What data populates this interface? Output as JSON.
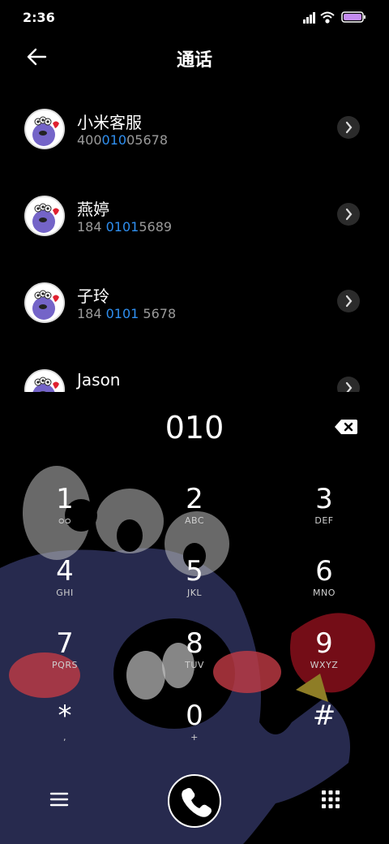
{
  "status": {
    "time": "2:36"
  },
  "header": {
    "title": "通话"
  },
  "contacts": [
    {
      "name": "小米客服",
      "number_pre": "400",
      "number_hl": "010",
      "number_post": "05678"
    },
    {
      "name": "燕婷",
      "number_pre": "184 ",
      "number_hl": "0101",
      "number_post": "5689"
    },
    {
      "name": "子玲",
      "number_pre": "184 ",
      "number_hl": "0101",
      "number_post": " 5678"
    },
    {
      "name": "Jason",
      "number_pre": "",
      "number_hl": "",
      "number_post": ""
    }
  ],
  "dialer": {
    "input": "010",
    "keys": [
      {
        "digit": "1",
        "letters": "ᴑᴑ"
      },
      {
        "digit": "2",
        "letters": "ABC"
      },
      {
        "digit": "3",
        "letters": "DEF"
      },
      {
        "digit": "4",
        "letters": "GHI"
      },
      {
        "digit": "5",
        "letters": "JKL"
      },
      {
        "digit": "6",
        "letters": "MNO"
      },
      {
        "digit": "7",
        "letters": "PQRS"
      },
      {
        "digit": "8",
        "letters": "TUV"
      },
      {
        "digit": "9",
        "letters": "WXYZ"
      },
      {
        "digit": "*",
        "letters": ","
      },
      {
        "digit": "0",
        "letters": "+"
      },
      {
        "digit": "#",
        "letters": ""
      }
    ]
  },
  "colors": {
    "highlight": "#2f8ff0",
    "background": "#000000",
    "monster": "#272a4e"
  }
}
